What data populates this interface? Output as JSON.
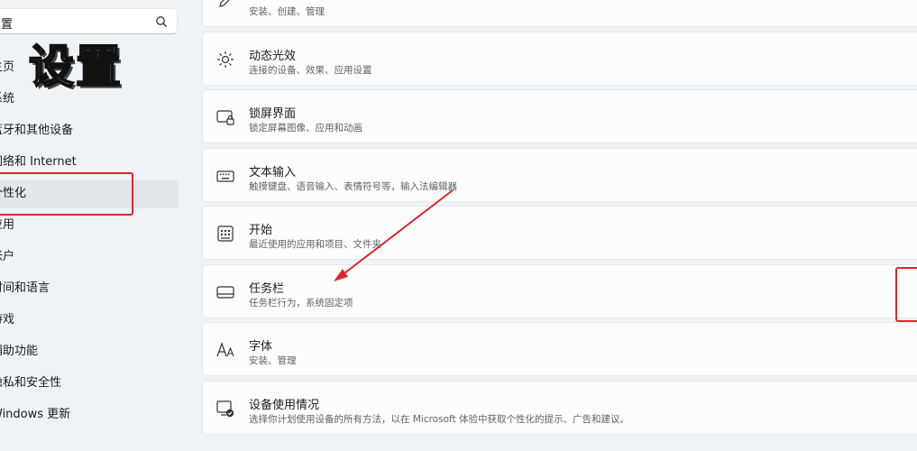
{
  "search": {
    "value": "置"
  },
  "overlay_title": "设置",
  "sidebar": {
    "items": [
      {
        "label": "主页",
        "active": false
      },
      {
        "label": "系统",
        "active": false
      },
      {
        "label": "蓝牙和其他设备",
        "active": false
      },
      {
        "label": "网络和 Internet",
        "active": false
      },
      {
        "label": "个性化",
        "active": true
      },
      {
        "label": "应用",
        "active": false
      },
      {
        "label": "帐户",
        "active": false
      },
      {
        "label": "时间和语言",
        "active": false
      },
      {
        "label": "游戏",
        "active": false
      },
      {
        "label": "辅助功能",
        "active": false
      },
      {
        "label": "隐私和安全性",
        "active": false
      },
      {
        "label": "Windows 更新",
        "active": false
      }
    ]
  },
  "cards": [
    {
      "icon": "pen-icon",
      "title": "",
      "desc": "安装、创建、管理"
    },
    {
      "icon": "dynamic-lighting-icon",
      "title": "动态光效",
      "desc": "连接的设备、效果、应用设置"
    },
    {
      "icon": "lock-screen-icon",
      "title": "锁屏界面",
      "desc": "锁定屏幕图像、应用和动画"
    },
    {
      "icon": "keyboard-icon",
      "title": "文本输入",
      "desc": "触摸键盘、语音输入、表情符号等，输入法编辑器"
    },
    {
      "icon": "start-menu-icon",
      "title": "开始",
      "desc": "最近使用的应用和项目、文件夹"
    },
    {
      "icon": "taskbar-icon",
      "title": "任务栏",
      "desc": "任务栏行为，系统固定项"
    },
    {
      "icon": "fonts-icon",
      "title": "字体",
      "desc": "安装、管理"
    },
    {
      "icon": "device-usage-icon",
      "title": "设备使用情况",
      "desc": "选择你计划使用设备的所有方法，以在 Microsoft 体验中获取个性化的提示、广告和建议。"
    }
  ],
  "colors": {
    "annotation": "#e0262a",
    "background": "#eef3f7",
    "card": "#fbfcfd"
  }
}
